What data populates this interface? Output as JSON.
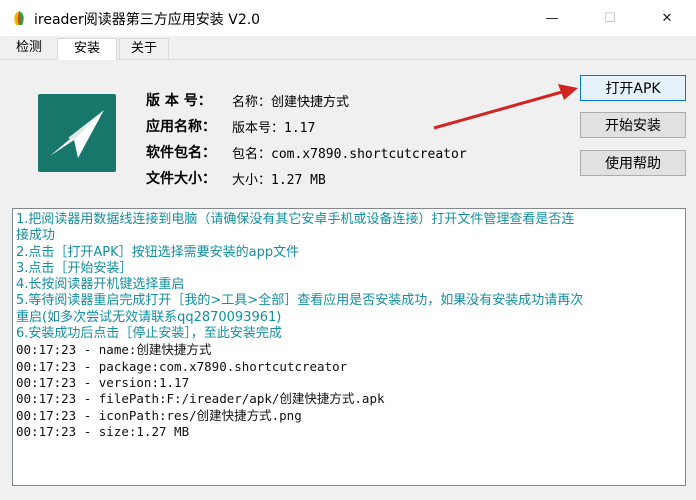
{
  "window": {
    "title": "ireader阅读器第三方应用安装 V2.0",
    "controls": {
      "minimize": "—",
      "maximize": "☐",
      "close": "✕"
    }
  },
  "tabs": [
    {
      "label": "检测"
    },
    {
      "label": "安装",
      "active": true
    },
    {
      "label": "关于"
    }
  ],
  "app_info": {
    "icon": "paper-plane-icon",
    "rows": [
      {
        "label": "版 本 号：",
        "value": "名称：创建快捷方式"
      },
      {
        "label": "应用名称：",
        "value": "版本号：1.17"
      },
      {
        "label": "软件包名：",
        "value": "包名：com.x7890.shortcutcreator"
      },
      {
        "label": "文件大小：",
        "value": "大小：1.27 MB"
      }
    ]
  },
  "buttons": {
    "open_apk": "打开APK",
    "start_install": "开始安装",
    "help": "使用帮助"
  },
  "colors": {
    "instructions": "#138f9e",
    "arrow": "#d32424",
    "apk_icon_bg": "#17776a"
  },
  "log": {
    "instructions": [
      "1.把阅读器用数据线连接到电脑（请确保没有其它安卓手机或设备连接）打开文件管理查看是否连",
      "接成功",
      "2.点击［打开APK］按钮选择需要安装的app文件",
      "3.点击［开始安装］",
      "4.长按阅读器开机键选择重启",
      "5.等待阅读器重启完成打开［我的>工具>全部］查看应用是否安装成功，如果没有安装成功请再次",
      "重启(如多次尝试无效请联系qq2870093961)",
      "6.安装成功后点击［停止安装］，至此安装完成"
    ],
    "entries": [
      "00:17:23 - name:创建快捷方式",
      "00:17:23 - package:com.x7890.shortcutcreator",
      "00:17:23 - version:1.17",
      "00:17:23 - filePath:F:/ireader/apk/创建快捷方式.apk",
      "00:17:23 - iconPath:res/创建快捷方式.png",
      "00:17:23 - size:1.27 MB"
    ]
  }
}
